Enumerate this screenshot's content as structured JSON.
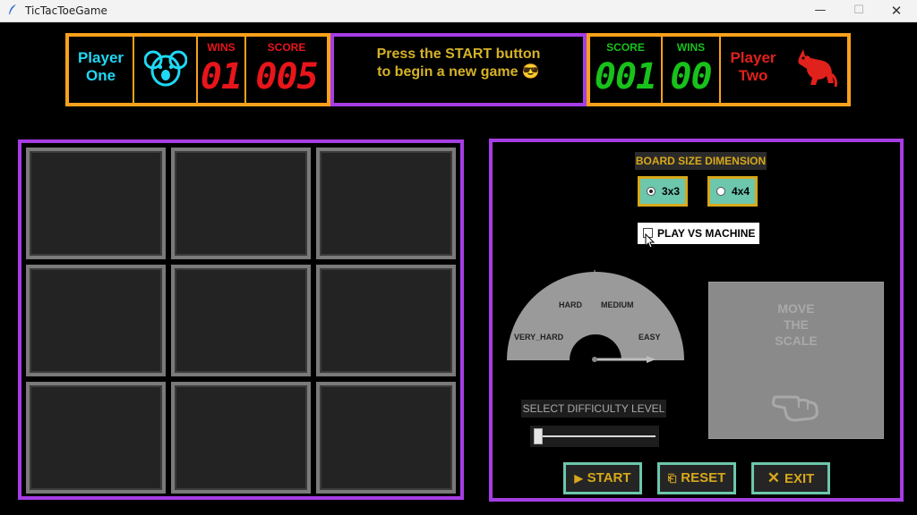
{
  "window": {
    "title": "TicTacToeGame",
    "minimize": "—",
    "maximize": "☐",
    "close": "✕"
  },
  "player_one": {
    "name_line1": "Player",
    "name_line2": "One",
    "icon": "koala-icon",
    "wins_label": "WINS",
    "wins": "01",
    "score_label": "SCORE",
    "score": "005"
  },
  "message": {
    "line1": "Press the START button",
    "line2": "to begin a new game 😎"
  },
  "player_two": {
    "name_line1": "Player",
    "name_line2": "Two",
    "icon": "kangaroo-icon",
    "score_label": "SCORE",
    "score": "001",
    "wins_label": "WINS",
    "wins": "00"
  },
  "board": {
    "size": "3x3",
    "cells": [
      "",
      "",
      "",
      "",
      "",
      "",
      "",
      "",
      ""
    ]
  },
  "settings": {
    "board_size_label": "BOARD SIZE DIMENSION",
    "options": [
      {
        "label": "3x3",
        "selected": true
      },
      {
        "label": "4x4",
        "selected": false
      }
    ],
    "vs_machine_label": "PLAY VS MACHINE",
    "vs_machine_checked": false,
    "gauge_labels": {
      "very_hard": "VERY_HARD",
      "hard": "HARD",
      "medium": "MEDIUM",
      "easy": "EASY"
    },
    "difficulty_label": "SELECT DIFFICULTY LEVEL",
    "difficulty_value": 0,
    "scale_text": [
      "MOVE",
      "THE",
      "SCALE"
    ]
  },
  "actions": {
    "start": "START",
    "reset": "RESET",
    "exit": "EXIT"
  },
  "colors": {
    "accent_orange": "#f9a11b",
    "accent_purple": "#a63de4",
    "accent_teal": "#6cc7ac",
    "p1_color": "#1fd8f4",
    "p2_color": "#e1211b",
    "gold": "#d7a81b"
  }
}
